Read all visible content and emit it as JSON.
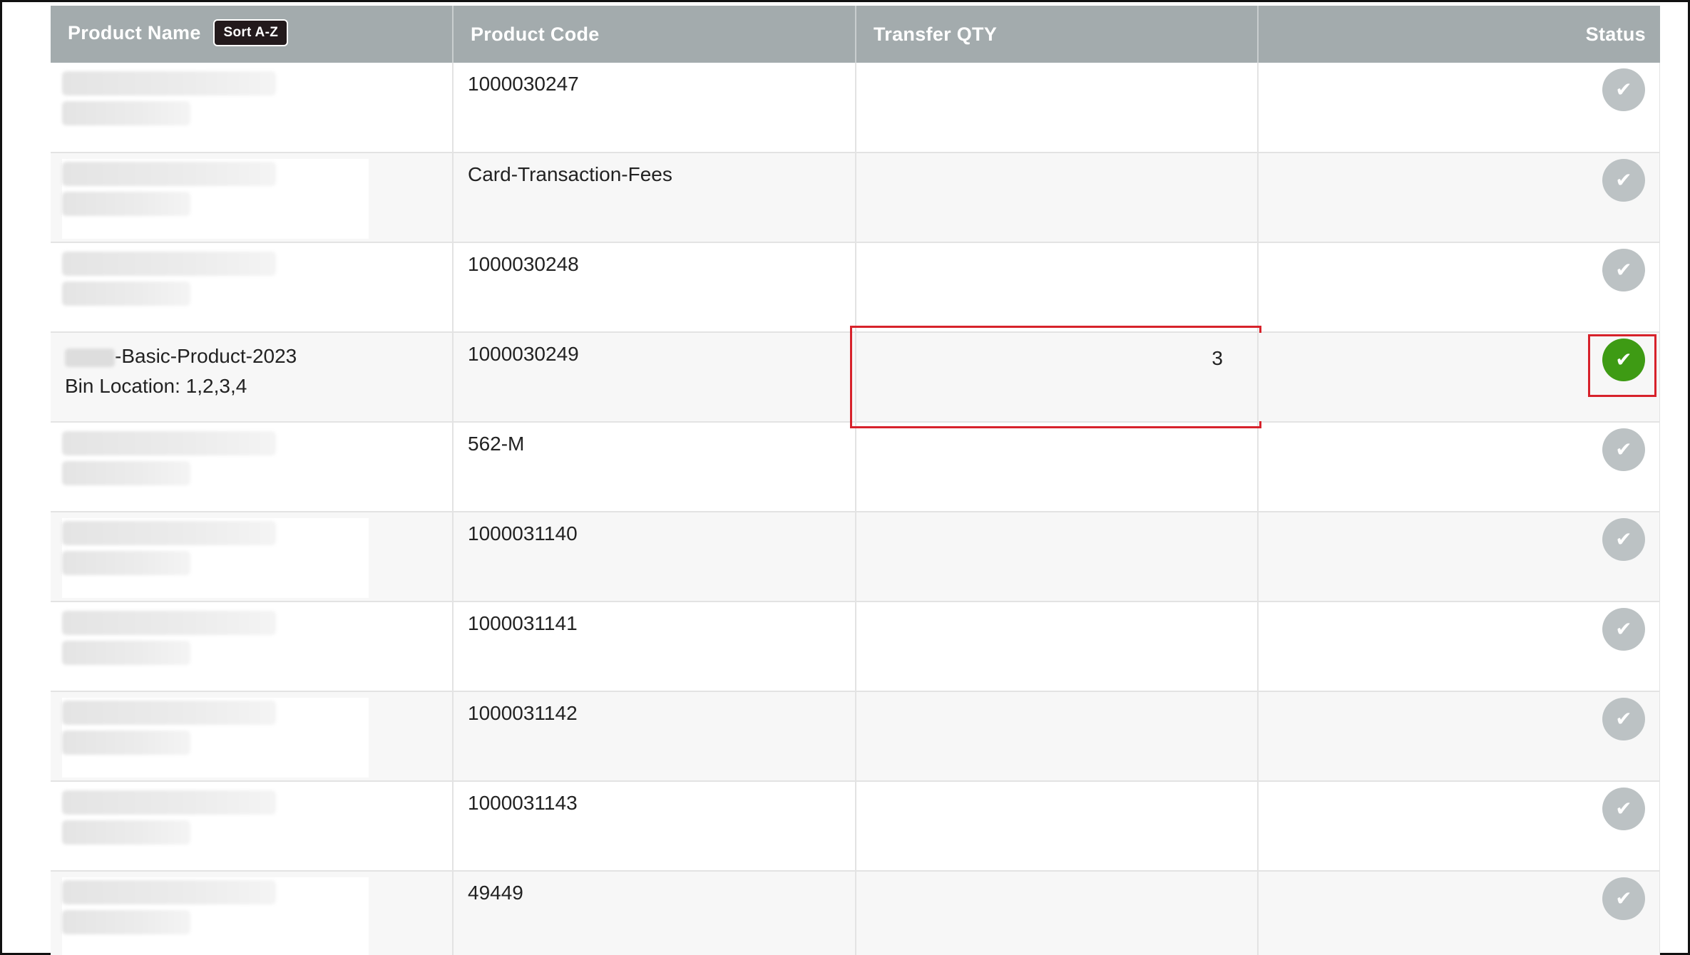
{
  "header": {
    "product_name": "Product Name",
    "sort_label": "Sort A-Z",
    "product_code": "Product Code",
    "transfer_qty": "Transfer QTY",
    "status": "Status"
  },
  "rows": [
    {
      "name_visible": false,
      "code": "1000030247",
      "qty": "",
      "status_active": false
    },
    {
      "name_visible": false,
      "code": "Card-Transaction-Fees",
      "qty": "",
      "status_active": false
    },
    {
      "name_visible": false,
      "code": "1000030248",
      "qty": "",
      "status_active": false
    },
    {
      "name_visible": true,
      "name": "-Basic-Product-2023",
      "bin": "Bin Location: 1,2,3,4",
      "code": "1000030249",
      "qty": "3",
      "status_active": true
    },
    {
      "name_visible": false,
      "code": "562-M",
      "qty": "",
      "status_active": false
    },
    {
      "name_visible": false,
      "code": "1000031140",
      "qty": "",
      "status_active": false
    },
    {
      "name_visible": false,
      "code": "1000031141",
      "qty": "",
      "status_active": false
    },
    {
      "name_visible": false,
      "code": "1000031142",
      "qty": "",
      "status_active": false
    },
    {
      "name_visible": false,
      "code": "1000031143",
      "qty": "",
      "status_active": false
    },
    {
      "name_visible": false,
      "code": "49449",
      "qty": "",
      "status_active": false
    }
  ],
  "icons": {
    "status": "checkmark-icon"
  },
  "colors": {
    "header_bg": "#a3abad",
    "status_active": "#3e9b14",
    "status_inactive": "#bcc2c4",
    "highlight": "#d7222b"
  }
}
